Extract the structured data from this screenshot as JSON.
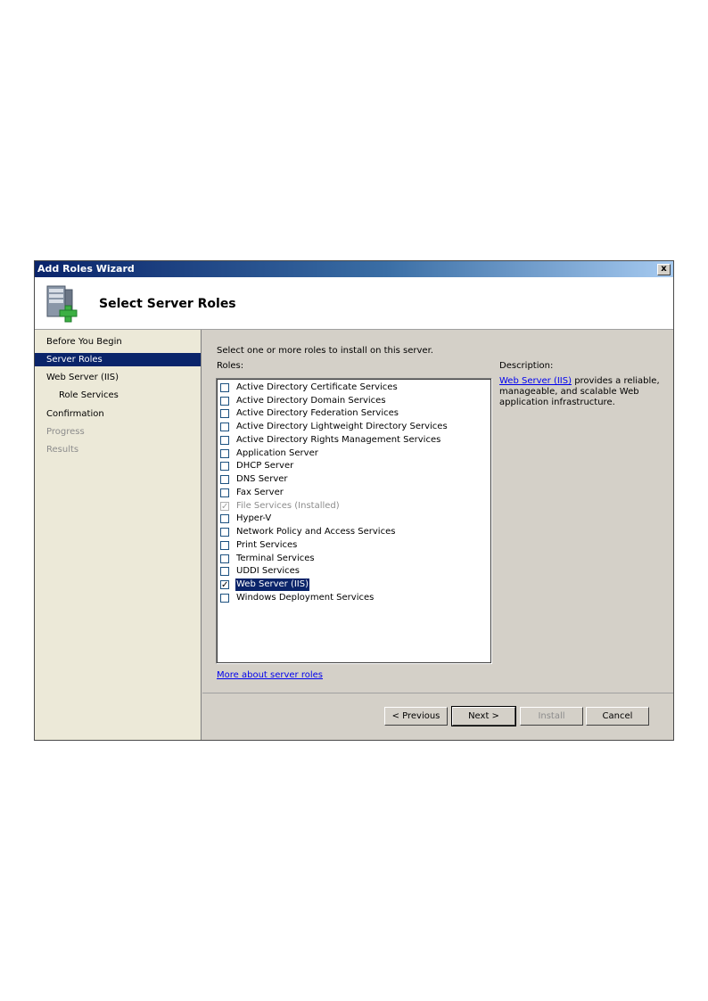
{
  "window": {
    "title": "Add Roles Wizard",
    "close_label": "x"
  },
  "header": {
    "page_title": "Select Server Roles"
  },
  "nav": {
    "items": [
      {
        "label": "Before You Begin",
        "state": "normal"
      },
      {
        "label": "Server Roles",
        "state": "selected"
      },
      {
        "label": "Web Server (IIS)",
        "state": "normal"
      },
      {
        "label": "Role Services",
        "state": "sub"
      },
      {
        "label": "Confirmation",
        "state": "normal"
      },
      {
        "label": "Progress",
        "state": "disabled"
      },
      {
        "label": "Results",
        "state": "disabled"
      }
    ]
  },
  "content": {
    "intro": "Select one or more roles to install on this server.",
    "roles_label": "Roles:",
    "roles": [
      {
        "label": "Active Directory Certificate Services",
        "checked": false,
        "disabled": false
      },
      {
        "label": "Active Directory Domain Services",
        "checked": false,
        "disabled": false
      },
      {
        "label": "Active Directory Federation Services",
        "checked": false,
        "disabled": false
      },
      {
        "label": "Active Directory Lightweight Directory Services",
        "checked": false,
        "disabled": false
      },
      {
        "label": "Active Directory Rights Management Services",
        "checked": false,
        "disabled": false
      },
      {
        "label": "Application Server",
        "checked": false,
        "disabled": false
      },
      {
        "label": "DHCP Server",
        "checked": false,
        "disabled": false
      },
      {
        "label": "DNS Server",
        "checked": false,
        "disabled": false
      },
      {
        "label": "Fax Server",
        "checked": false,
        "disabled": false
      },
      {
        "label": "File Services  (Installed)",
        "checked": true,
        "disabled": true
      },
      {
        "label": "Hyper-V",
        "checked": false,
        "disabled": false
      },
      {
        "label": "Network Policy and Access Services",
        "checked": false,
        "disabled": false
      },
      {
        "label": "Print Services",
        "checked": false,
        "disabled": false
      },
      {
        "label": "Terminal Services",
        "checked": false,
        "disabled": false
      },
      {
        "label": "UDDI Services",
        "checked": false,
        "disabled": false
      },
      {
        "label": "Web Server (IIS)",
        "checked": true,
        "disabled": false,
        "selected": true
      },
      {
        "label": "Windows Deployment Services",
        "checked": false,
        "disabled": false
      }
    ],
    "description_heading": "Description:",
    "description_link": "Web Server (IIS)",
    "description_text": " provides a reliable, manageable, and scalable Web application infrastructure.",
    "more_link": "More about server roles"
  },
  "footer": {
    "previous": "< Previous",
    "next": "Next >",
    "install": "Install",
    "cancel": "Cancel"
  },
  "colors": {
    "selection": "#0a246a",
    "link": "#0000ee",
    "dialog_bg": "#d4d0c8",
    "icon_plus": "#3cb043"
  },
  "icons": {
    "header": "server-add-icon",
    "close": "close-icon",
    "checkbox_check": "✓"
  }
}
